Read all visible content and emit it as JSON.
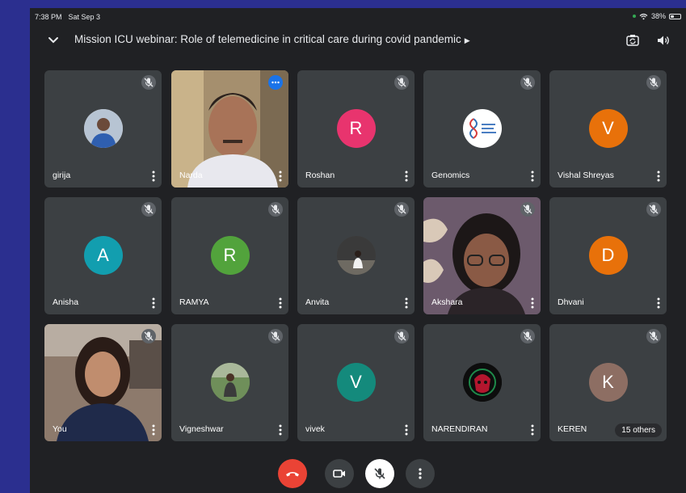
{
  "status_bar": {
    "time": "7:38 PM",
    "date": "Sat Sep 3",
    "battery": "38%"
  },
  "meeting": {
    "title": "Mission ICU webinar: Role of telemedicine in critical care during covid pandemic"
  },
  "colors": {
    "background": "#202124",
    "tile": "#3c4043",
    "end_call": "#ea4335",
    "avatar_roshan": "#e8346e",
    "avatar_vishal": "#e8710a",
    "avatar_anisha": "#129eaf",
    "avatar_ramya": "#52a33c",
    "avatar_dhvani": "#e8710a",
    "avatar_vivek": "#148a7c",
    "avatar_keren": "#8d6e63"
  },
  "participants": [
    {
      "name": "girija"
    },
    {
      "name": "Narda"
    },
    {
      "name": "Roshan",
      "initial": "R"
    },
    {
      "name": "Genomics"
    },
    {
      "name": "Vishal Shreyas",
      "initial": "V"
    },
    {
      "name": "Anisha",
      "initial": "A"
    },
    {
      "name": "RAMYA",
      "initial": "R"
    },
    {
      "name": "Anvita"
    },
    {
      "name": "Akshara"
    },
    {
      "name": "Dhvani",
      "initial": "D"
    },
    {
      "name": "You"
    },
    {
      "name": "Vigneshwar"
    },
    {
      "name": "vivek",
      "initial": "V"
    },
    {
      "name": "NARENDIRAN"
    },
    {
      "name": "KEREN",
      "initial": "K"
    }
  ],
  "others_badge": "15 others",
  "controls": {
    "end_call_icon": "phone-hangup-icon",
    "camera_icon": "camera-icon",
    "mic_icon": "mic-off-icon",
    "more_icon": "more-vert-icon"
  }
}
